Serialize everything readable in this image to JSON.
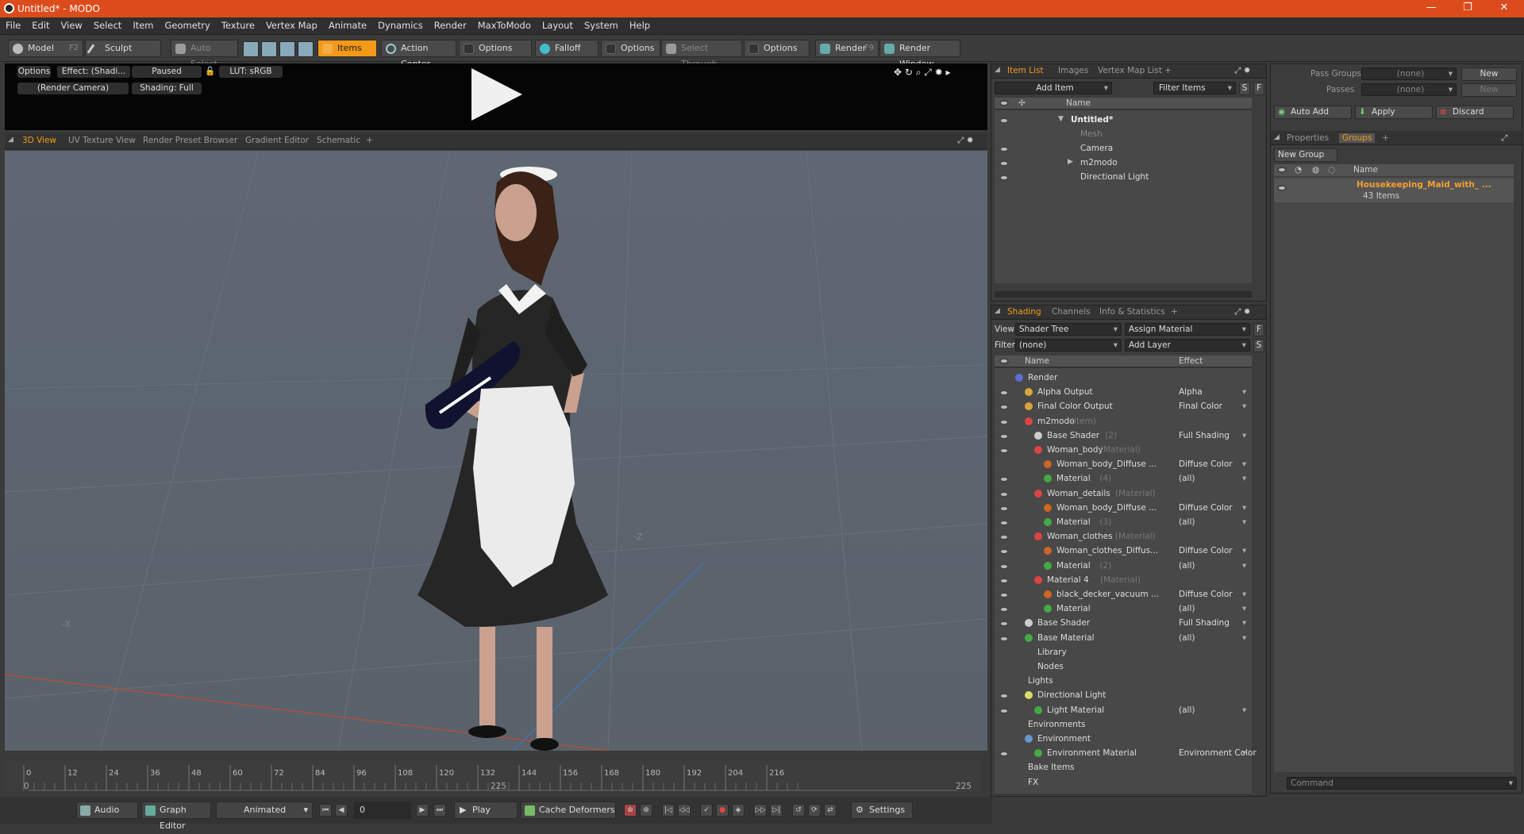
{
  "window": {
    "title": "Untitled* - MODO",
    "controls": [
      "—",
      "❐",
      "✕"
    ]
  },
  "menu": [
    "File",
    "Edit",
    "View",
    "Select",
    "Item",
    "Geometry",
    "Texture",
    "Vertex Map",
    "Animate",
    "Dynamics",
    "Render",
    "MaxToModo",
    "Layout",
    "System",
    "Help"
  ],
  "toolbar": {
    "model": "Model",
    "model_key": "F2",
    "sculpt": "Sculpt",
    "auto_select": "Auto Select",
    "items": "Items",
    "action_center": "Action Center",
    "options1": "Options",
    "falloff": "Falloff",
    "options2": "Options",
    "select_through": "Select Through",
    "options3": "Options",
    "render": "Render",
    "render_key": "F9",
    "render_window": "Render Window"
  },
  "preview": {
    "options": "Options",
    "effect": "Effect: (Shadi...",
    "paused": "Paused",
    "lut": "LUT: sRGB",
    "camera": "(Render Camera)",
    "shading": "Shading: Full"
  },
  "view_tabs": [
    "3D View",
    "UV Texture View",
    "Render Preset Browser",
    "Gradient Editor",
    "Schematic",
    "+"
  ],
  "viewport": {
    "axis_z": "-Z",
    "axis_x": "-X"
  },
  "timeline": {
    "ticks": [
      "0",
      "12",
      "24",
      "36",
      "48",
      "60",
      "72",
      "84",
      "96",
      "108",
      "120",
      "132",
      "144",
      "156",
      "168",
      "180",
      "192",
      "204",
      "216"
    ],
    "start": "0",
    "end_mid": "225",
    "end": "225"
  },
  "bottom": {
    "audio": "Audio",
    "graph_editor": "Graph Editor",
    "animated": "Animated",
    "frame": "0",
    "play": "Play",
    "cache_deformers": "Cache Deformers",
    "settings": "Settings"
  },
  "item_list": {
    "tabs": [
      "Item List",
      "Images",
      "Vertex Map List",
      "+"
    ],
    "add_item": "Add Item",
    "filter_items": "Filter Items",
    "s": "S",
    "f": "F",
    "col_name": "Name",
    "rows": [
      {
        "label": "Untitled*",
        "indent": 0,
        "style": "bold"
      },
      {
        "label": "Mesh",
        "indent": 1,
        "style": "dim"
      },
      {
        "label": "Camera",
        "indent": 1,
        "style": ""
      },
      {
        "label": "m2modo",
        "indent": 1,
        "style": ""
      },
      {
        "label": "Directional Light",
        "indent": 1,
        "style": ""
      }
    ]
  },
  "shading": {
    "tabs": [
      "Shading",
      "Channels",
      "Info & Statistics",
      "+"
    ],
    "view_label": "View",
    "view_value": "Shader Tree",
    "assign_material": "Assign Material",
    "f": "F",
    "filter_label": "Filter",
    "filter_value": "(none)",
    "add_layer": "Add Layer",
    "s": "S",
    "col_name": "Name",
    "col_effect": "Effect",
    "rows": [
      {
        "label": "Render",
        "sub": "",
        "effect": "",
        "indent": 0,
        "eye": false,
        "color": "#5b6fd6"
      },
      {
        "label": "Alpha Output",
        "sub": "",
        "effect": "Alpha",
        "indent": 1,
        "eye": true,
        "color": "#d9a53a"
      },
      {
        "label": "Final Color Output",
        "sub": "",
        "effect": "Final Color",
        "indent": 1,
        "eye": true,
        "color": "#d9a53a"
      },
      {
        "label": "m2modo",
        "sub": "(Item)",
        "effect": "",
        "indent": 1,
        "eye": true,
        "color": "#d44"
      },
      {
        "label": "Base Shader",
        "sub": "(2)",
        "effect": "Full Shading",
        "indent": 2,
        "eye": true,
        "color": "#ccc"
      },
      {
        "label": "Woman_body",
        "sub": "(Material)",
        "effect": "",
        "indent": 2,
        "eye": true,
        "color": "#d44"
      },
      {
        "label": "Woman_body_Diffuse ...",
        "sub": "",
        "effect": "Diffuse Color",
        "indent": 3,
        "eye": false,
        "color": "#c62"
      },
      {
        "label": "Material",
        "sub": "(4)",
        "effect": "(all)",
        "indent": 3,
        "eye": true,
        "color": "#4a4"
      },
      {
        "label": "Woman_details",
        "sub": "(Material)",
        "effect": "",
        "indent": 2,
        "eye": true,
        "color": "#d44"
      },
      {
        "label": "Woman_body_Diffuse ...",
        "sub": "",
        "effect": "Diffuse Color",
        "indent": 3,
        "eye": true,
        "color": "#c62"
      },
      {
        "label": "Material",
        "sub": "(3)",
        "effect": "(all)",
        "indent": 3,
        "eye": true,
        "color": "#4a4"
      },
      {
        "label": "Woman_clothes",
        "sub": "(Material)",
        "effect": "",
        "indent": 2,
        "eye": true,
        "color": "#d44"
      },
      {
        "label": "Woman_clothes_Diffus...",
        "sub": "",
        "effect": "Diffuse Color",
        "indent": 3,
        "eye": true,
        "color": "#c62"
      },
      {
        "label": "Material",
        "sub": "(2)",
        "effect": "(all)",
        "indent": 3,
        "eye": true,
        "color": "#4a4"
      },
      {
        "label": "Material 4",
        "sub": "(Material)",
        "effect": "",
        "indent": 2,
        "eye": true,
        "color": "#d44"
      },
      {
        "label": "black_decker_vacuum ...",
        "sub": "",
        "effect": "Diffuse Color",
        "indent": 3,
        "eye": true,
        "color": "#c62"
      },
      {
        "label": "Material",
        "sub": "",
        "effect": "(all)",
        "indent": 3,
        "eye": true,
        "color": "#4a4"
      },
      {
        "label": "Base Shader",
        "sub": "",
        "effect": "Full Shading",
        "indent": 1,
        "eye": true,
        "color": "#ccc"
      },
      {
        "label": "Base Material",
        "sub": "",
        "effect": "(all)",
        "indent": 1,
        "eye": true,
        "color": "#4a4"
      },
      {
        "label": "Library",
        "sub": "",
        "effect": "",
        "indent": 1,
        "eye": false,
        "color": ""
      },
      {
        "label": "Nodes",
        "sub": "",
        "effect": "",
        "indent": 1,
        "eye": false,
        "color": ""
      },
      {
        "label": "Lights",
        "sub": "",
        "effect": "",
        "indent": 0,
        "eye": false,
        "color": ""
      },
      {
        "label": "Directional Light",
        "sub": "",
        "effect": "",
        "indent": 1,
        "eye": true,
        "color": "#dd6"
      },
      {
        "label": "Light Material",
        "sub": "",
        "effect": "(all)",
        "indent": 2,
        "eye": true,
        "color": "#4a4"
      },
      {
        "label": "Environments",
        "sub": "",
        "effect": "",
        "indent": 0,
        "eye": false,
        "color": ""
      },
      {
        "label": "Environment",
        "sub": "",
        "effect": "",
        "indent": 1,
        "eye": false,
        "color": "#69c"
      },
      {
        "label": "Environment Material",
        "sub": "",
        "effect": "Environment Color",
        "indent": 2,
        "eye": true,
        "color": "#4a4"
      },
      {
        "label": "Bake Items",
        "sub": "",
        "effect": "",
        "indent": 0,
        "eye": false,
        "color": ""
      },
      {
        "label": "FX",
        "sub": "",
        "effect": "",
        "indent": 0,
        "eye": false,
        "color": ""
      }
    ]
  },
  "right": {
    "pass_groups": "Pass Groups",
    "pass_groups_val": "(none)",
    "new": "New",
    "passes": "Passes",
    "passes_val": "(none)",
    "new2": "New",
    "auto_add": "Auto Add",
    "apply": "Apply",
    "discard": "Discard",
    "tabs": [
      "Properties",
      "Groups",
      "+"
    ],
    "new_group": "New Group",
    "col_name": "Name",
    "group_name": "Housekeeping_Maid_with_ ...",
    "group_count": "43 Items",
    "command_placeholder": "Command"
  },
  "colors": {
    "accent": "#f29a18",
    "titlebar": "#dc4b1b"
  }
}
